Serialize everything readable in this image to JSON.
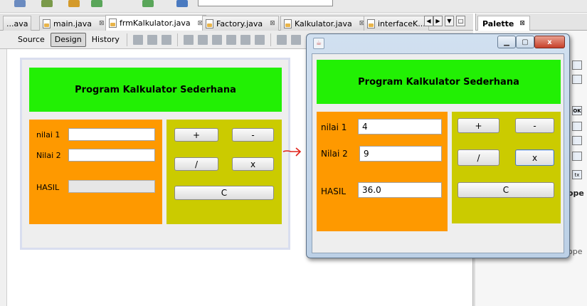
{
  "editor_tabs": [
    {
      "label": "...ava",
      "close": ""
    },
    {
      "label": "main.java",
      "close": "⊠"
    },
    {
      "label": "frmKalkulator.java",
      "close": "⊠",
      "active": true
    },
    {
      "label": "Factory.java",
      "close": "⊠"
    },
    {
      "label": "Kalkulator.java",
      "close": "⊠"
    },
    {
      "label": "interfaceK...",
      "close": ""
    }
  ],
  "tab_nav": [
    "◀",
    "▶",
    "▼",
    "□"
  ],
  "palette": {
    "title": "Palette",
    "close": "⊠",
    "side_text": [
      "ope"
    ]
  },
  "design_toolbar": {
    "source": "Source",
    "design": "Design",
    "history": "History"
  },
  "form": {
    "title": "Program Kalkulator Sederhana",
    "label_nilai1": "nilai 1",
    "label_nilai2": "Nilai 2",
    "label_hasil": "HASIL",
    "btn_plus": "+",
    "btn_minus": "-",
    "btn_div": "/",
    "btn_mul": "x",
    "btn_clear": "C"
  },
  "running": {
    "nilai1_value": "4",
    "nilai2_value": "9",
    "hasil_value": "36.0",
    "win_icon": "☕",
    "min": "▁",
    "max": "▢",
    "close": "x"
  },
  "colors": {
    "title_panel": "#22f004",
    "input_panel": "#fe9900",
    "button_panel": "#cbcb00",
    "arrow": "#e0231a"
  }
}
